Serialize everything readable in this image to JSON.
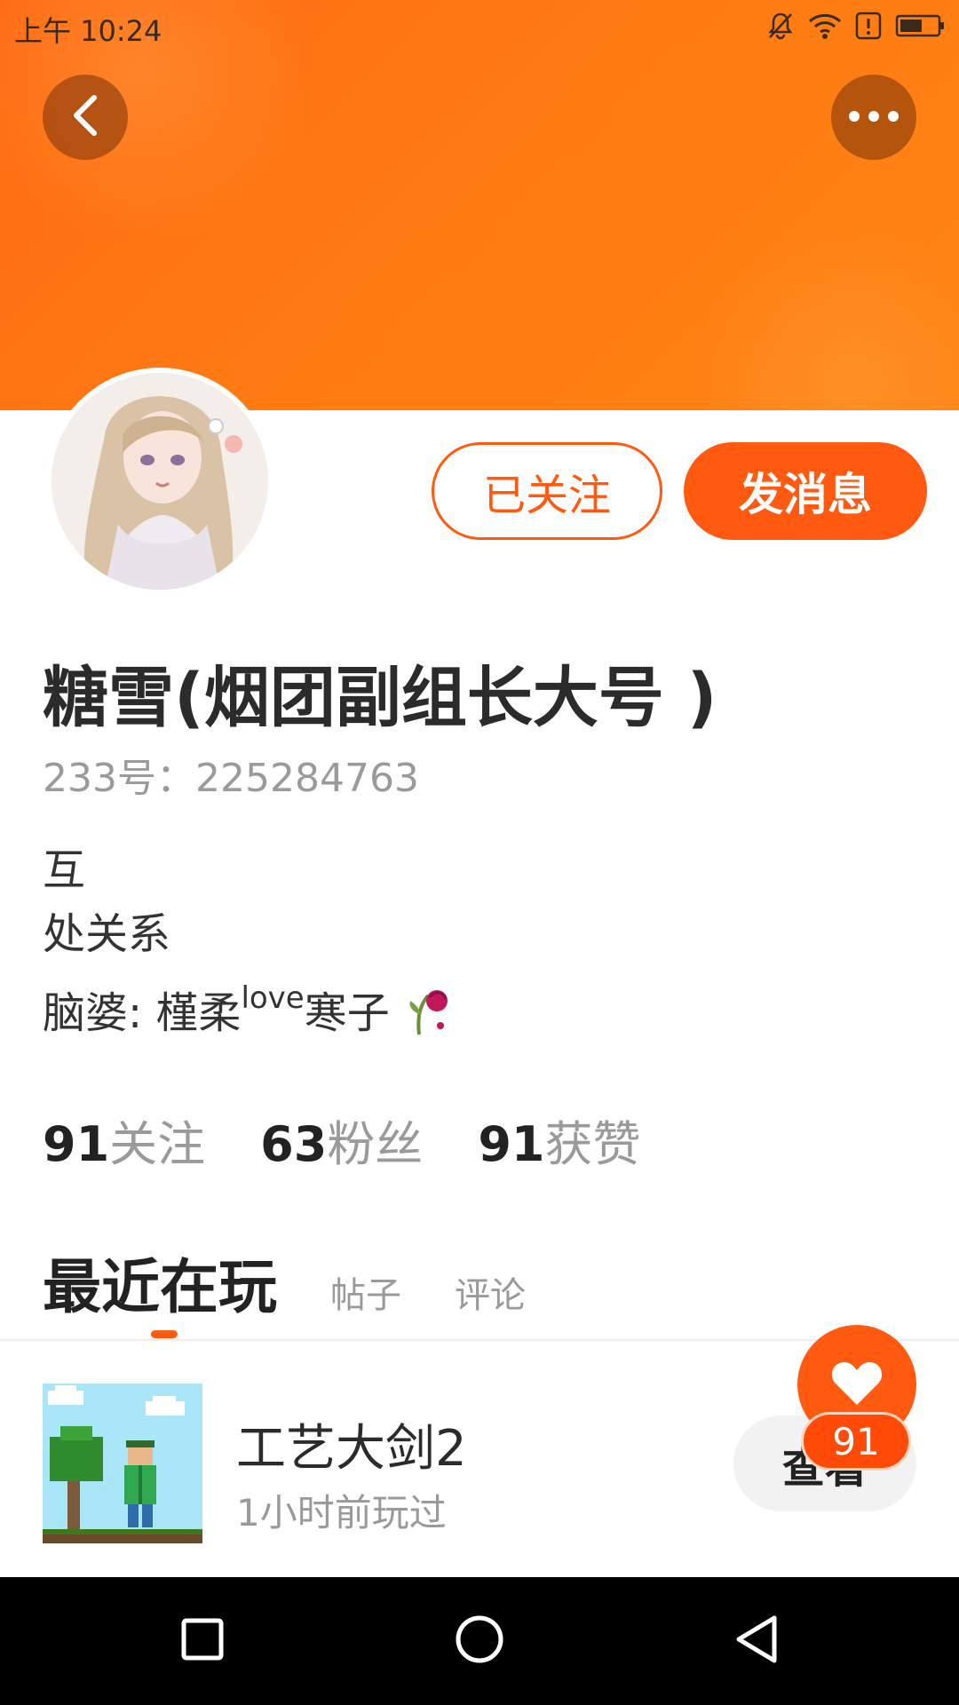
{
  "status_bar": {
    "time": "上午 10:24",
    "icons": [
      "bell-muted-icon",
      "wifi-icon",
      "alert-icon",
      "battery-icon"
    ]
  },
  "header": {
    "back_icon": "chevron-left-icon",
    "more_icon": "more-horizontal-icon",
    "accent_color": "#ff5a10"
  },
  "profile": {
    "follow_label": "已关注",
    "message_label": "发消息",
    "nickname": "糖雪(烟团副组长大号 )",
    "uid": "233号：225284763",
    "bio": {
      "line1": "互",
      "line2": "处关系",
      "line3_prefix": "脑婆: 槿柔",
      "line3_sup": "love",
      "line3_suffix": "寒子"
    },
    "stats": [
      {
        "value": "91",
        "label": "关注"
      },
      {
        "value": "63",
        "label": "粉丝"
      },
      {
        "value": "91",
        "label": "获赞"
      }
    ]
  },
  "tabs": [
    {
      "label": "最近在玩",
      "active": true
    },
    {
      "label": "帖子",
      "active": false
    },
    {
      "label": "评论",
      "active": false
    }
  ],
  "recent_game": {
    "title": "工艺大剑2",
    "subtitle": "1小时前玩过",
    "button_label": "查看"
  },
  "like": {
    "icon": "heart-icon",
    "count": "91"
  },
  "nav_bar": {
    "icons": [
      "recent-apps-icon",
      "home-icon",
      "back-icon"
    ]
  }
}
